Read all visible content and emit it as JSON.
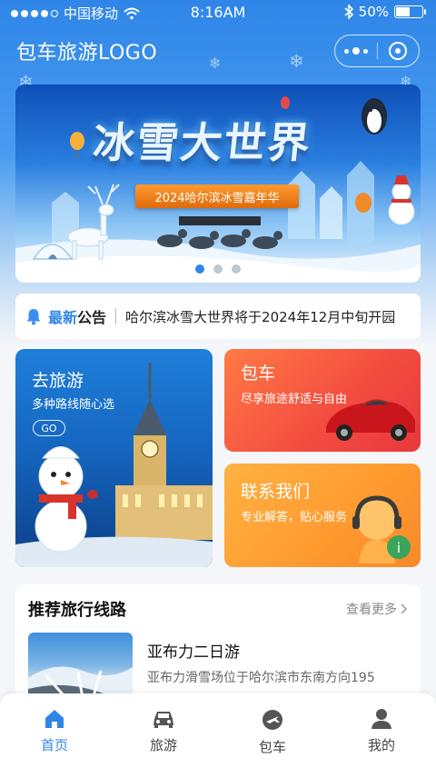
{
  "status_bar": {
    "carrier": "中国移动",
    "time": "8:16AM",
    "battery": "50%",
    "battery_level": 0.5
  },
  "header": {
    "title": "包车旅游LOGO"
  },
  "banner": {
    "title": "冰雪大世界",
    "subtitle": "2024哈尔滨冰雪嘉年华",
    "page_count": 3,
    "active_index": 0
  },
  "notice": {
    "label_highlight": "最新",
    "label_rest": "公告",
    "text": "哈尔滨冰雪大世界将于2024年12月中旬开园"
  },
  "cards": {
    "tour": {
      "title": "去旅游",
      "subtitle": "多种路线随心选",
      "button": "GO"
    },
    "charter": {
      "title": "包车",
      "subtitle": "尽享旅途舒适与自由"
    },
    "contact": {
      "title": "联系我们",
      "subtitle": "专业解答，贴心服务"
    }
  },
  "recommend": {
    "title": "推荐旅行线路",
    "more": "查看更多",
    "items": [
      {
        "title": "亚布力二日游",
        "desc": "亚布力滑雪场位于哈尔滨市东南方向195"
      }
    ]
  },
  "tabbar": {
    "items": [
      {
        "label": "首页",
        "icon": "home-icon",
        "active": true
      },
      {
        "label": "旅游",
        "icon": "car-icon",
        "active": false
      },
      {
        "label": "包车",
        "icon": "travel-icon",
        "active": false
      },
      {
        "label": "我的",
        "icon": "user-icon",
        "active": false
      }
    ]
  },
  "colors": {
    "primary": "#2f86e8",
    "charter": "#f24b3f",
    "contact": "#ff9a2f"
  }
}
